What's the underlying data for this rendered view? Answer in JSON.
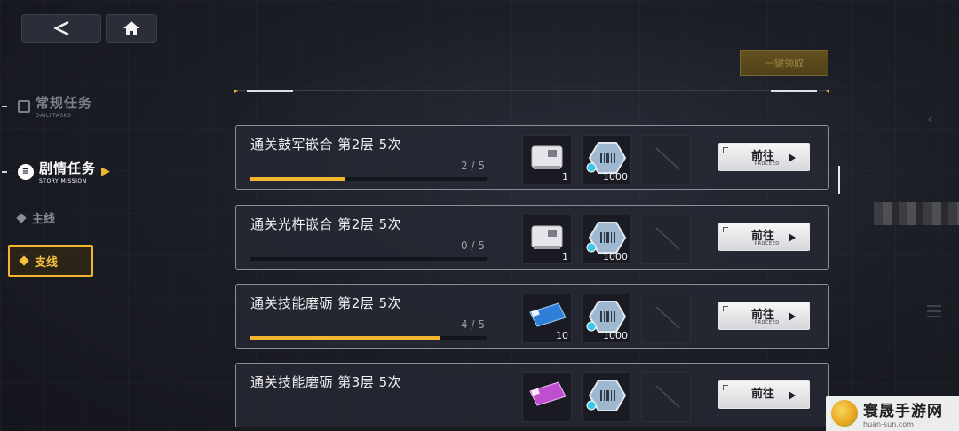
{
  "nav": {
    "back_icon": "back-arrow-icon",
    "home_icon": "home-icon"
  },
  "claim_all": {
    "label": "一键领取"
  },
  "sidebar": {
    "tabs": [
      {
        "zh": "常规任务",
        "en": "DAILYTASKS",
        "icon": "list-icon"
      },
      {
        "zh": "剧情任务",
        "en": "STORY MISSION",
        "icon": "circle-list-icon"
      }
    ],
    "sub": [
      {
        "label": "主线"
      },
      {
        "label": "支线"
      }
    ]
  },
  "tasks": [
    {
      "title": "通关鼓军嵌合 第2层 5次",
      "progress_text": "2 / 5",
      "progress": 0.4,
      "rewards": [
        {
          "icon": "ticket-item-icon",
          "qty": "1"
        },
        {
          "icon": "barcode-crystal-icon",
          "qty": "1000"
        },
        {
          "icon": "empty-slot-icon",
          "qty": ""
        }
      ],
      "button": {
        "label": "前往",
        "sub": "PROCEED"
      }
    },
    {
      "title": "通关光杵嵌合 第2层 5次",
      "progress_text": "0 / 5",
      "progress": 0.0,
      "rewards": [
        {
          "icon": "ticket-item-icon",
          "qty": "1"
        },
        {
          "icon": "barcode-crystal-icon",
          "qty": "1000"
        },
        {
          "icon": "empty-slot-icon",
          "qty": ""
        }
      ],
      "button": {
        "label": "前往",
        "sub": "PROCEED"
      }
    },
    {
      "title": "通关技能磨砺 第2层 5次",
      "progress_text": "4 / 5",
      "progress": 0.8,
      "rewards": [
        {
          "icon": "blue-ticket-icon",
          "qty": "10"
        },
        {
          "icon": "barcode-crystal-icon",
          "qty": "1000"
        },
        {
          "icon": "empty-slot-icon",
          "qty": ""
        }
      ],
      "button": {
        "label": "前往",
        "sub": "PROCEED"
      }
    },
    {
      "title": "通关技能磨砺 第3层 5次",
      "progress_text": "",
      "progress": null,
      "rewards": [
        {
          "icon": "pink-ticket-icon",
          "qty": ""
        },
        {
          "icon": "barcode-crystal-icon",
          "qty": ""
        },
        {
          "icon": "empty-slot-icon",
          "qty": ""
        }
      ],
      "button": {
        "label": "前往",
        "sub": ""
      }
    }
  ],
  "watermark": {
    "zh": "寰晟手游网",
    "en": "huan-sun.com"
  },
  "colors": {
    "accent": "#f2b530",
    "panel_border": "#8b8f9a",
    "background": "#1c1e27"
  }
}
